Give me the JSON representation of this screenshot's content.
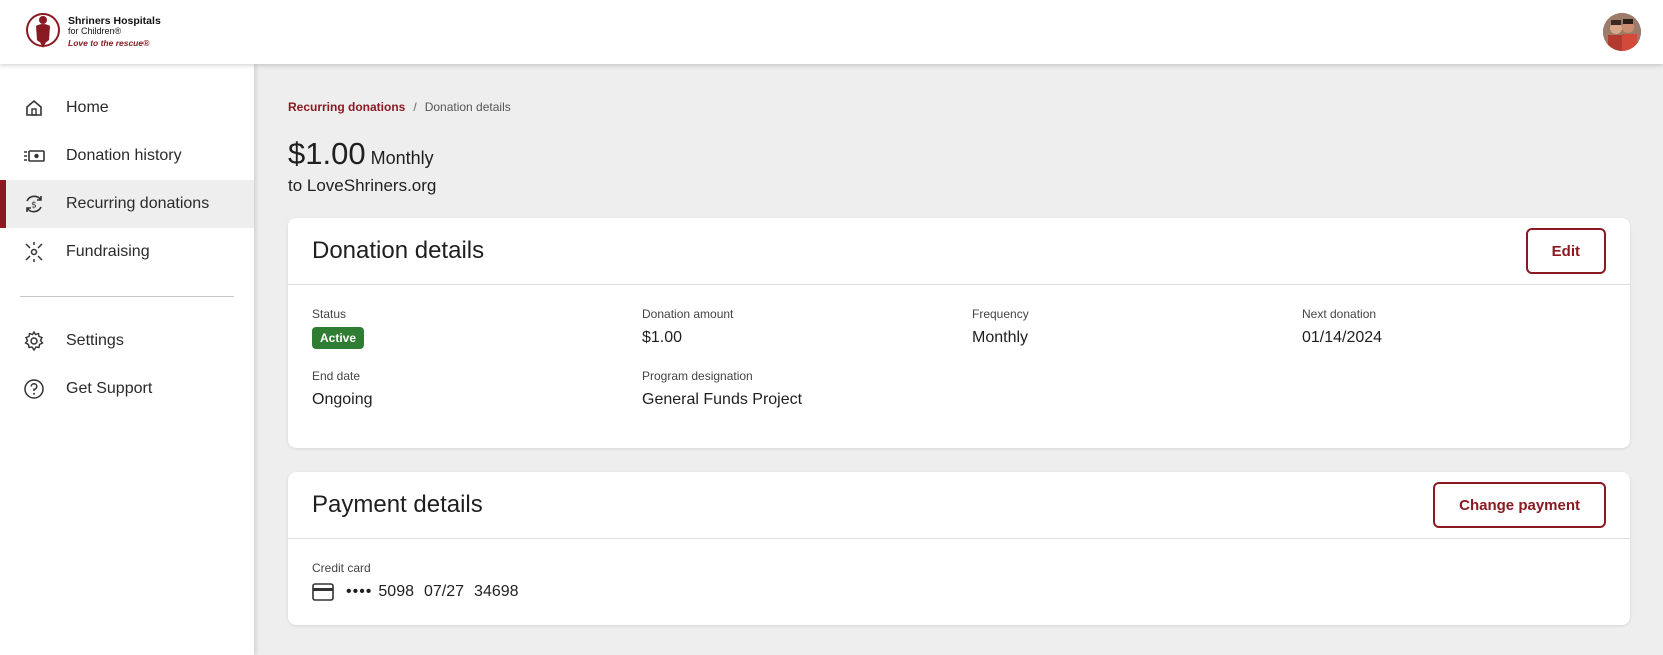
{
  "header": {
    "logo": {
      "line1": "Shriners Hospitals",
      "line2": "for Children®",
      "line3": "Love to the rescue®"
    },
    "avatar_icon": "user-avatar"
  },
  "sidebar": {
    "items": [
      {
        "label": "Home",
        "icon": "home-icon",
        "active": false
      },
      {
        "label": "Donation history",
        "icon": "donation-history-icon",
        "active": false
      },
      {
        "label": "Recurring donations",
        "icon": "recurring-icon",
        "active": true
      },
      {
        "label": "Fundraising",
        "icon": "fundraising-icon",
        "active": false
      }
    ],
    "secondary": [
      {
        "label": "Settings",
        "icon": "gear-icon"
      },
      {
        "label": "Get Support",
        "icon": "help-icon"
      }
    ]
  },
  "breadcrumb": {
    "parent": "Recurring donations",
    "separator": "/",
    "current": "Donation details"
  },
  "summary": {
    "amount": "$1.00",
    "frequency": "Monthly",
    "recipient": "to LoveShriners.org"
  },
  "donation_details": {
    "title": "Donation details",
    "edit_label": "Edit",
    "status_label": "Status",
    "status_value": "Active",
    "amount_label": "Donation amount",
    "amount_value": "$1.00",
    "frequency_label": "Frequency",
    "frequency_value": "Monthly",
    "next_label": "Next donation",
    "next_value": "01/14/2024",
    "end_label": "End date",
    "end_value": "Ongoing",
    "program_label": "Program designation",
    "program_value": "General Funds Project"
  },
  "payment_details": {
    "title": "Payment details",
    "change_label": "Change payment",
    "method_label": "Credit card",
    "card_dots": "••••",
    "card_last4": "5098",
    "card_expiry": "07/27",
    "card_zip": "34698"
  },
  "colors": {
    "brand": "#8a1a22",
    "status_active": "#2e7d32",
    "background": "#eeeeee"
  }
}
